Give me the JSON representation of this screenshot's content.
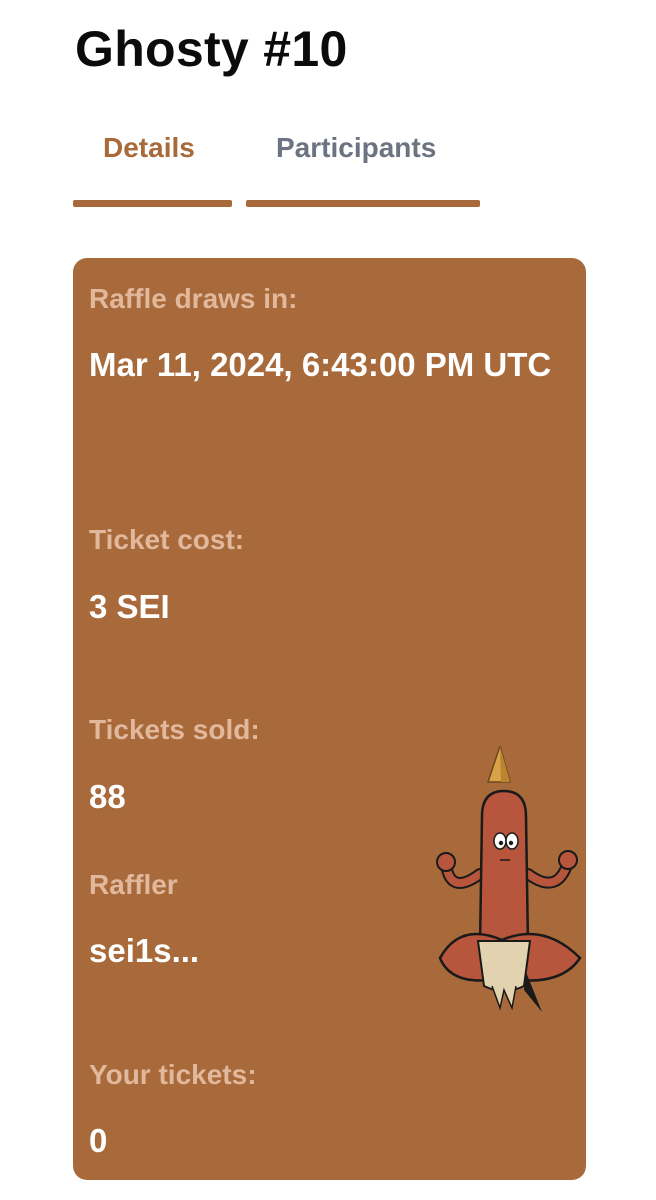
{
  "header": {
    "title": "Ghosty #10"
  },
  "tabs": [
    {
      "label": "Details",
      "active": true
    },
    {
      "label": "Participants",
      "active": false
    }
  ],
  "details": {
    "draw_label": "Raffle draws in:",
    "draw_value": "Mar 11, 2024, 6:43:00 PM UTC",
    "cost_label": "Ticket cost:",
    "cost_value": "3 SEI",
    "sold_label": "Tickets sold:",
    "sold_value": "88",
    "raffler_label": "Raffler",
    "raffler_value": "sei1s...",
    "your_label": "Your tickets:",
    "your_value": "0"
  },
  "colors": {
    "accent": "#a86a3b",
    "label": "#e2b89c",
    "tab_inactive": "#6b7280"
  }
}
